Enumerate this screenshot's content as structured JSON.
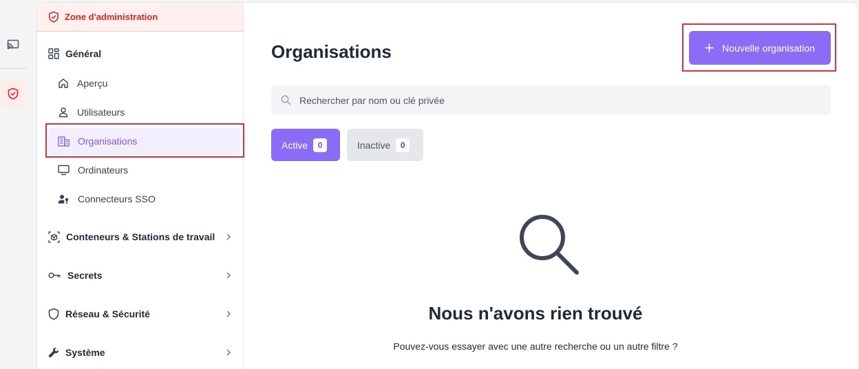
{
  "admin_zone": {
    "label": "Zone d'administration"
  },
  "sidebar": {
    "general": {
      "label": "Général",
      "items": [
        {
          "label": "Aperçu",
          "icon": "home-icon"
        },
        {
          "label": "Utilisateurs",
          "icon": "user-icon"
        },
        {
          "label": "Organisations",
          "icon": "building-icon",
          "active": true
        },
        {
          "label": "Ordinateurs",
          "icon": "monitor-icon"
        },
        {
          "label": "Connecteurs SSO",
          "icon": "user-key-icon"
        }
      ]
    },
    "groups": [
      {
        "label": "Conteneurs & Stations de travail",
        "icon": "cube-icon"
      },
      {
        "label": "Secrets",
        "icon": "key-icon"
      },
      {
        "label": "Réseau & Sécurité",
        "icon": "shield-icon"
      },
      {
        "label": "Système",
        "icon": "wrench-icon"
      }
    ]
  },
  "main": {
    "title": "Organisations",
    "new_button": "Nouvelle organisation",
    "search_placeholder": "Rechercher par nom ou clé privée",
    "tabs": [
      {
        "label": "Active",
        "count": "0"
      },
      {
        "label": "Inactive",
        "count": "0"
      }
    ],
    "empty": {
      "title": "Nous n'avons rien trouvé",
      "subtitle": "Pouvez-vous essayer avec une autre recherche ou un autre filtre ?"
    }
  },
  "colors": {
    "accent": "#8b6cf6",
    "admin_red": "#dc2626",
    "highlight": "#e5303a"
  }
}
